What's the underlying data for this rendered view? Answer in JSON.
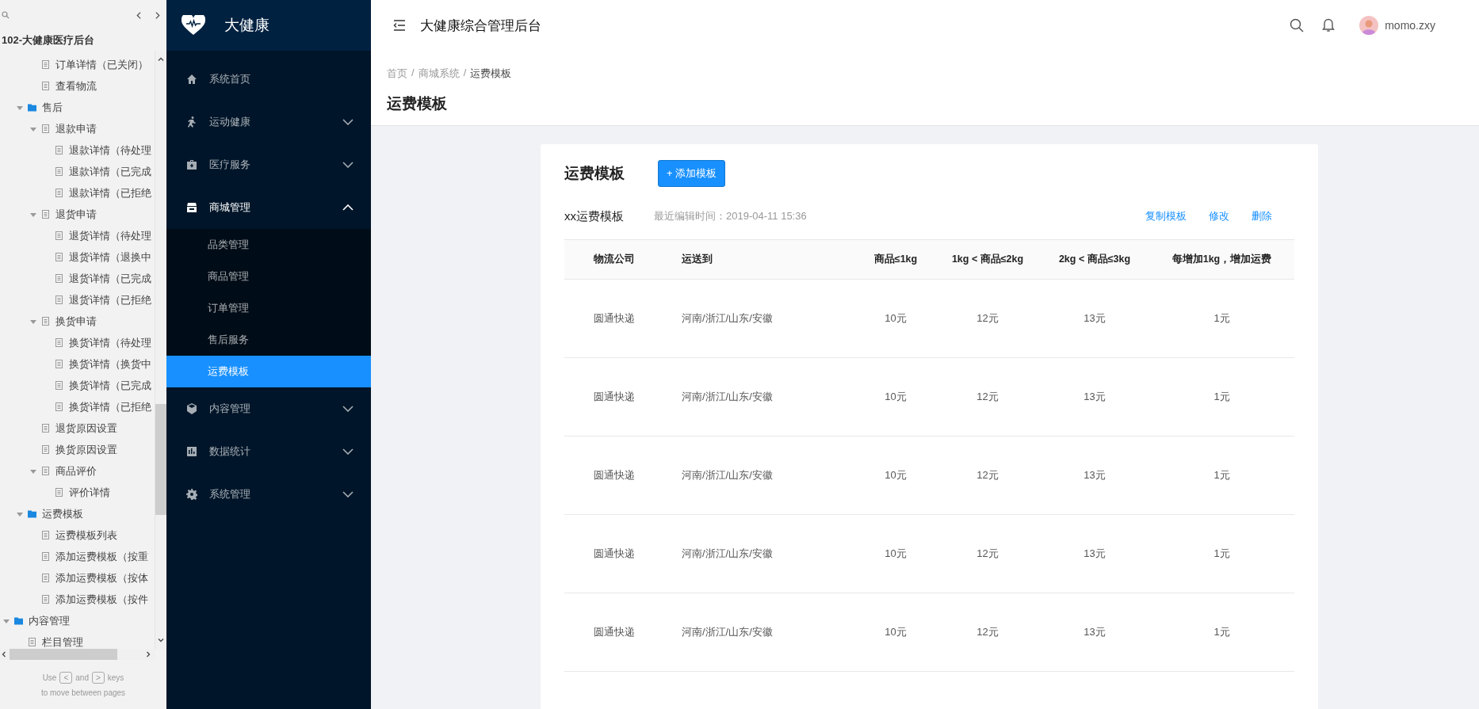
{
  "outline": {
    "title": "102-大健康医疗后台",
    "items": [
      {
        "children": [
          {
            "children": [
              {
                "kind": "page",
                "label": "订单详情（已关闭）"
              },
              {
                "kind": "page",
                "label": "查看物流"
              }
            ]
          },
          {
            "kind": "folder",
            "label": "售后",
            "expanded": true,
            "children": [
              {
                "kind": "page",
                "label": "退款申请",
                "expanded": true,
                "children": [
                  {
                    "kind": "page",
                    "label": "退款详情（待处理"
                  },
                  {
                    "kind": "page",
                    "label": "退款详情（已完成"
                  },
                  {
                    "kind": "page",
                    "label": "退款详情（已拒绝"
                  }
                ]
              },
              {
                "kind": "page",
                "label": "退货申请",
                "expanded": true,
                "children": [
                  {
                    "kind": "page",
                    "label": "退货详情（待处理"
                  },
                  {
                    "kind": "page",
                    "label": "退货详情（退换中"
                  },
                  {
                    "kind": "page",
                    "label": "退货详情（已完成"
                  },
                  {
                    "kind": "page",
                    "label": "退货详情（已拒绝"
                  }
                ]
              },
              {
                "kind": "page",
                "label": "换货申请",
                "expanded": true,
                "children": [
                  {
                    "kind": "page",
                    "label": "换货详情（待处理"
                  },
                  {
                    "kind": "page",
                    "label": "换货详情（换货中"
                  },
                  {
                    "kind": "page",
                    "label": "换货详情（已完成"
                  },
                  {
                    "kind": "page",
                    "label": "换货详情（已拒绝"
                  }
                ]
              },
              {
                "kind": "page",
                "label": "退货原因设置"
              },
              {
                "kind": "page",
                "label": "换货原因设置"
              },
              {
                "kind": "page",
                "label": "商品评价",
                "expanded": true,
                "children": [
                  {
                    "kind": "page",
                    "label": "评价详情"
                  }
                ]
              }
            ]
          },
          {
            "kind": "folder",
            "label": "运费模板",
            "expanded": true,
            "children": [
              {
                "kind": "page",
                "label": "运费模板列表"
              },
              {
                "kind": "page",
                "label": "添加运费模板（按重"
              },
              {
                "kind": "page",
                "label": "添加运费模板（按体"
              },
              {
                "kind": "page",
                "label": "添加运费模板（按件"
              }
            ]
          }
        ]
      },
      {
        "kind": "folder",
        "label": "内容管理",
        "expanded": true,
        "children": [
          {
            "kind": "page",
            "label": "栏目管理"
          }
        ]
      }
    ],
    "footer": {
      "use": "Use",
      "prev_key": "<",
      "and": "and",
      "next_key": ">",
      "keys": "keys",
      "hint": "to move between pages"
    }
  },
  "sidebar": {
    "brand": "大健康",
    "menu": [
      {
        "label": "系统首页"
      },
      {
        "label": "运动健康",
        "expanded": false
      },
      {
        "label": "医疗服务",
        "expanded": false
      },
      {
        "label": "商城管理",
        "expanded": true,
        "children": [
          {
            "label": "品类管理",
            "selected": false
          },
          {
            "label": "商品管理",
            "selected": false
          },
          {
            "label": "订单管理",
            "selected": false
          },
          {
            "label": "售后服务",
            "selected": false
          },
          {
            "label": "运费模板",
            "selected": true
          }
        ]
      },
      {
        "label": "内容管理",
        "expanded": false
      },
      {
        "label": "数据统计",
        "expanded": false
      },
      {
        "label": "系统管理",
        "expanded": false
      }
    ]
  },
  "header": {
    "title": "大健康综合管理后台",
    "user": "momo.zxy"
  },
  "breadcrumb": {
    "separator": "/",
    "items": [
      "首页",
      "商城系统",
      "运费模板"
    ]
  },
  "page_title": "运费模板",
  "card": {
    "title": "运费模板",
    "add_button": "+ 添加模板",
    "template": {
      "name": "xx运费模板",
      "edited": "最近编辑时间：2019-04-11 15:36",
      "actions": [
        "复制模板",
        "修改",
        "删除"
      ]
    },
    "table": {
      "columns": [
        "物流公司",
        "运送到",
        "商品≤1kg",
        "1kg < 商品≤2kg",
        "2kg < 商品≤3kg",
        "每增加1kg，增加运费"
      ],
      "rows": [
        [
          "圆通快递",
          "河南/浙江/山东/安徽",
          "10元",
          "12元",
          "13元",
          "1元"
        ],
        [
          "圆通快递",
          "河南/浙江/山东/安徽",
          "10元",
          "12元",
          "13元",
          "1元"
        ],
        [
          "圆通快递",
          "河南/浙江/山东/安徽",
          "10元",
          "12元",
          "13元",
          "1元"
        ],
        [
          "圆通快递",
          "河南/浙江/山东/安徽",
          "10元",
          "12元",
          "13元",
          "1元"
        ],
        [
          "圆通快递",
          "河南/浙江/山东/安徽",
          "10元",
          "12元",
          "13元",
          "1元"
        ]
      ]
    }
  }
}
